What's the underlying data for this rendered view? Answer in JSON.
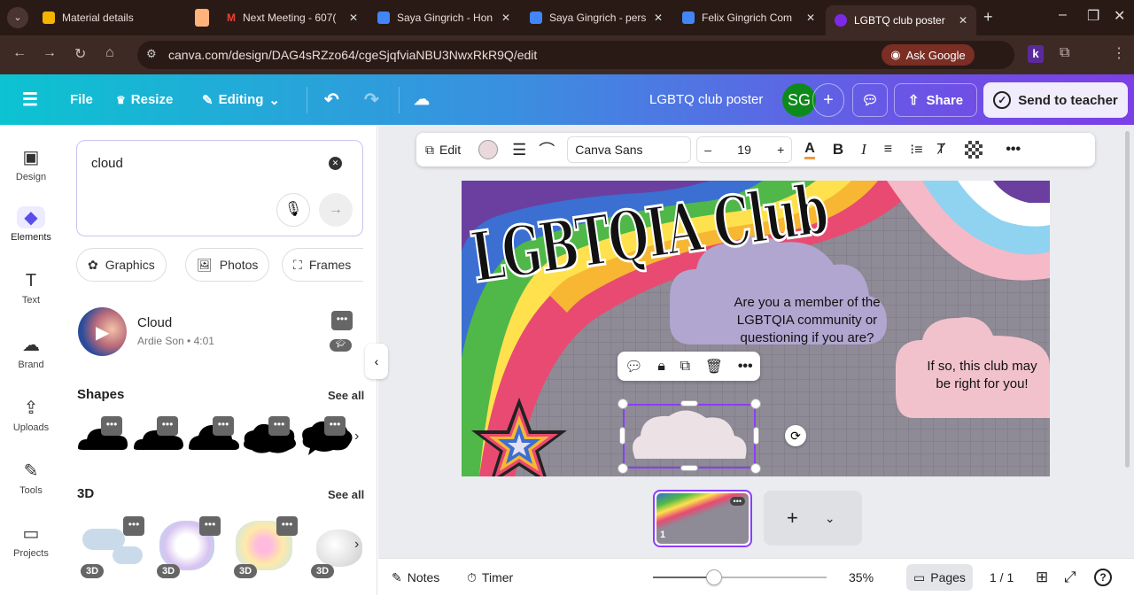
{
  "browser": {
    "tabs": [
      {
        "title": "Material details",
        "color": "#f4b400"
      },
      {
        "title": "",
        "color": "#ffb27a"
      },
      {
        "title": "Next Meeting - 607(",
        "color": "#ea4335"
      },
      {
        "title": "Saya Gingrich - Hon",
        "color": "#4285f4"
      },
      {
        "title": "Saya Gingrich - pers",
        "color": "#4285f4"
      },
      {
        "title": "Felix Gingrich Com",
        "color": "#4285f4"
      },
      {
        "title": "LGBTQ club poster",
        "color": "#7d2ae8"
      }
    ],
    "url": "canva.com/design/DAG4sRZzo64/cgeSjqfviaNBU3NwxRkR9Q/edit",
    "ask_google": "Ask Google",
    "ext_label": "k"
  },
  "header": {
    "file": "File",
    "resize": "Resize",
    "editing": "Editing",
    "doc_title": "LGBTQ club poster",
    "avatar": "SG",
    "share": "Share",
    "send": "Send to teacher"
  },
  "rail": [
    {
      "label": "Design",
      "icon": "▣"
    },
    {
      "label": "Elements",
      "icon": "◆"
    },
    {
      "label": "Text",
      "icon": "T"
    },
    {
      "label": "Brand",
      "icon": "☁"
    },
    {
      "label": "Uploads",
      "icon": "⇪"
    },
    {
      "label": "Tools",
      "icon": "✎"
    },
    {
      "label": "Projects",
      "icon": "▭"
    }
  ],
  "panel": {
    "search_value": "cloud",
    "chips": [
      "Graphics",
      "Photos",
      "Frames"
    ],
    "audio": {
      "title": "Cloud",
      "meta": "Ardie Son • 4:01"
    },
    "shapes_title": "Shapes",
    "see_all": "See all",
    "three_d_title": "3D",
    "badge_3d": "3D"
  },
  "format_bar": {
    "edit": "Edit",
    "font": "Canva Sans",
    "font_size": "19",
    "minus": "–",
    "plus": "+"
  },
  "poster": {
    "title": "LGBTQIA Club",
    "q1": "Are you a member of the LGBTQIA community or questioning if you are?",
    "q2": "If so, this club may be right for you!"
  },
  "pages": {
    "page_num": "1"
  },
  "bottom": {
    "notes": "Notes",
    "timer": "Timer",
    "zoom": "35%",
    "zoom_fraction": 0.35,
    "pages": "Pages",
    "page_count": "1 / 1"
  }
}
